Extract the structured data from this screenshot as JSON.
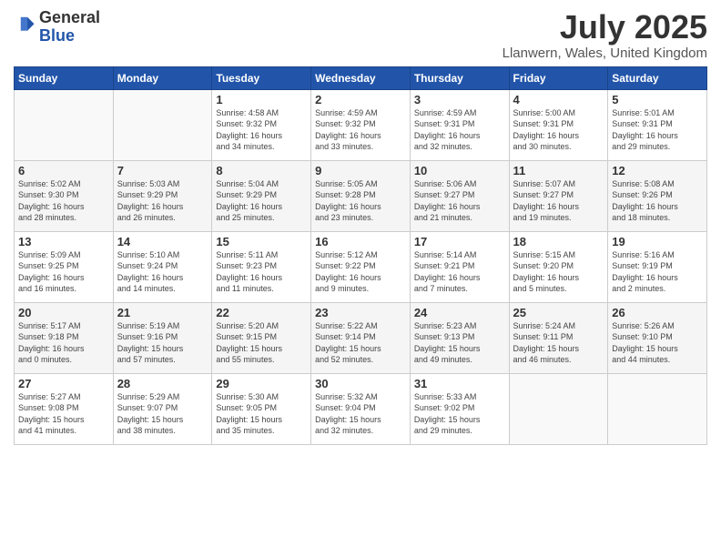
{
  "header": {
    "logo_line1": "General",
    "logo_line2": "Blue",
    "title": "July 2025",
    "location": "Llanwern, Wales, United Kingdom"
  },
  "weekdays": [
    "Sunday",
    "Monday",
    "Tuesday",
    "Wednesday",
    "Thursday",
    "Friday",
    "Saturday"
  ],
  "weeks": [
    [
      {
        "day": "",
        "info": ""
      },
      {
        "day": "",
        "info": ""
      },
      {
        "day": "1",
        "info": "Sunrise: 4:58 AM\nSunset: 9:32 PM\nDaylight: 16 hours\nand 34 minutes."
      },
      {
        "day": "2",
        "info": "Sunrise: 4:59 AM\nSunset: 9:32 PM\nDaylight: 16 hours\nand 33 minutes."
      },
      {
        "day": "3",
        "info": "Sunrise: 4:59 AM\nSunset: 9:31 PM\nDaylight: 16 hours\nand 32 minutes."
      },
      {
        "day": "4",
        "info": "Sunrise: 5:00 AM\nSunset: 9:31 PM\nDaylight: 16 hours\nand 30 minutes."
      },
      {
        "day": "5",
        "info": "Sunrise: 5:01 AM\nSunset: 9:31 PM\nDaylight: 16 hours\nand 29 minutes."
      }
    ],
    [
      {
        "day": "6",
        "info": "Sunrise: 5:02 AM\nSunset: 9:30 PM\nDaylight: 16 hours\nand 28 minutes."
      },
      {
        "day": "7",
        "info": "Sunrise: 5:03 AM\nSunset: 9:29 PM\nDaylight: 16 hours\nand 26 minutes."
      },
      {
        "day": "8",
        "info": "Sunrise: 5:04 AM\nSunset: 9:29 PM\nDaylight: 16 hours\nand 25 minutes."
      },
      {
        "day": "9",
        "info": "Sunrise: 5:05 AM\nSunset: 9:28 PM\nDaylight: 16 hours\nand 23 minutes."
      },
      {
        "day": "10",
        "info": "Sunrise: 5:06 AM\nSunset: 9:27 PM\nDaylight: 16 hours\nand 21 minutes."
      },
      {
        "day": "11",
        "info": "Sunrise: 5:07 AM\nSunset: 9:27 PM\nDaylight: 16 hours\nand 19 minutes."
      },
      {
        "day": "12",
        "info": "Sunrise: 5:08 AM\nSunset: 9:26 PM\nDaylight: 16 hours\nand 18 minutes."
      }
    ],
    [
      {
        "day": "13",
        "info": "Sunrise: 5:09 AM\nSunset: 9:25 PM\nDaylight: 16 hours\nand 16 minutes."
      },
      {
        "day": "14",
        "info": "Sunrise: 5:10 AM\nSunset: 9:24 PM\nDaylight: 16 hours\nand 14 minutes."
      },
      {
        "day": "15",
        "info": "Sunrise: 5:11 AM\nSunset: 9:23 PM\nDaylight: 16 hours\nand 11 minutes."
      },
      {
        "day": "16",
        "info": "Sunrise: 5:12 AM\nSunset: 9:22 PM\nDaylight: 16 hours\nand 9 minutes."
      },
      {
        "day": "17",
        "info": "Sunrise: 5:14 AM\nSunset: 9:21 PM\nDaylight: 16 hours\nand 7 minutes."
      },
      {
        "day": "18",
        "info": "Sunrise: 5:15 AM\nSunset: 9:20 PM\nDaylight: 16 hours\nand 5 minutes."
      },
      {
        "day": "19",
        "info": "Sunrise: 5:16 AM\nSunset: 9:19 PM\nDaylight: 16 hours\nand 2 minutes."
      }
    ],
    [
      {
        "day": "20",
        "info": "Sunrise: 5:17 AM\nSunset: 9:18 PM\nDaylight: 16 hours\nand 0 minutes."
      },
      {
        "day": "21",
        "info": "Sunrise: 5:19 AM\nSunset: 9:16 PM\nDaylight: 15 hours\nand 57 minutes."
      },
      {
        "day": "22",
        "info": "Sunrise: 5:20 AM\nSunset: 9:15 PM\nDaylight: 15 hours\nand 55 minutes."
      },
      {
        "day": "23",
        "info": "Sunrise: 5:22 AM\nSunset: 9:14 PM\nDaylight: 15 hours\nand 52 minutes."
      },
      {
        "day": "24",
        "info": "Sunrise: 5:23 AM\nSunset: 9:13 PM\nDaylight: 15 hours\nand 49 minutes."
      },
      {
        "day": "25",
        "info": "Sunrise: 5:24 AM\nSunset: 9:11 PM\nDaylight: 15 hours\nand 46 minutes."
      },
      {
        "day": "26",
        "info": "Sunrise: 5:26 AM\nSunset: 9:10 PM\nDaylight: 15 hours\nand 44 minutes."
      }
    ],
    [
      {
        "day": "27",
        "info": "Sunrise: 5:27 AM\nSunset: 9:08 PM\nDaylight: 15 hours\nand 41 minutes."
      },
      {
        "day": "28",
        "info": "Sunrise: 5:29 AM\nSunset: 9:07 PM\nDaylight: 15 hours\nand 38 minutes."
      },
      {
        "day": "29",
        "info": "Sunrise: 5:30 AM\nSunset: 9:05 PM\nDaylight: 15 hours\nand 35 minutes."
      },
      {
        "day": "30",
        "info": "Sunrise: 5:32 AM\nSunset: 9:04 PM\nDaylight: 15 hours\nand 32 minutes."
      },
      {
        "day": "31",
        "info": "Sunrise: 5:33 AM\nSunset: 9:02 PM\nDaylight: 15 hours\nand 29 minutes."
      },
      {
        "day": "",
        "info": ""
      },
      {
        "day": "",
        "info": ""
      }
    ]
  ]
}
